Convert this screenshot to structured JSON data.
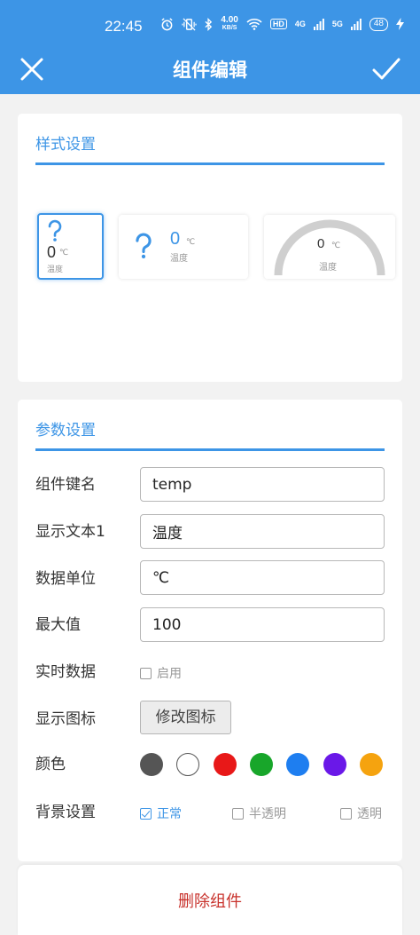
{
  "status_bar": {
    "time": "22:45",
    "net_speed": "4.00",
    "net_speed_unit": "KB/S",
    "hd_label": "HD",
    "net1": "4G",
    "net2": "5G",
    "battery": "48"
  },
  "header": {
    "title": "组件编辑"
  },
  "style_section": {
    "title": "样式设置",
    "options": [
      {
        "value": "0",
        "unit": "℃",
        "label": "温度"
      },
      {
        "value": "0",
        "unit": "℃",
        "label": "温度"
      },
      {
        "value": "0",
        "unit": "℃",
        "label": "温度"
      }
    ]
  },
  "params_section": {
    "title": "参数设置",
    "key_label": "组件键名",
    "key_value": "temp",
    "text_label": "显示文本1",
    "text_value": "温度",
    "unit_label": "数据单位",
    "unit_value": "℃",
    "max_label": "最大值",
    "max_value": "100",
    "realtime_label": "实时数据",
    "realtime_option": "启用",
    "icon_label": "显示图标",
    "icon_button": "修改图标",
    "color_label": "颜色",
    "colors": [
      "#555555",
      "#ffffff",
      "#e81818",
      "#18a62a",
      "#1e7ef0",
      "#6a18e8",
      "#f5a30f"
    ],
    "bg_label": "背景设置",
    "bg_options": [
      "正常",
      "半透明",
      "透明"
    ]
  },
  "footer": {
    "delete_label": "删除组件"
  }
}
